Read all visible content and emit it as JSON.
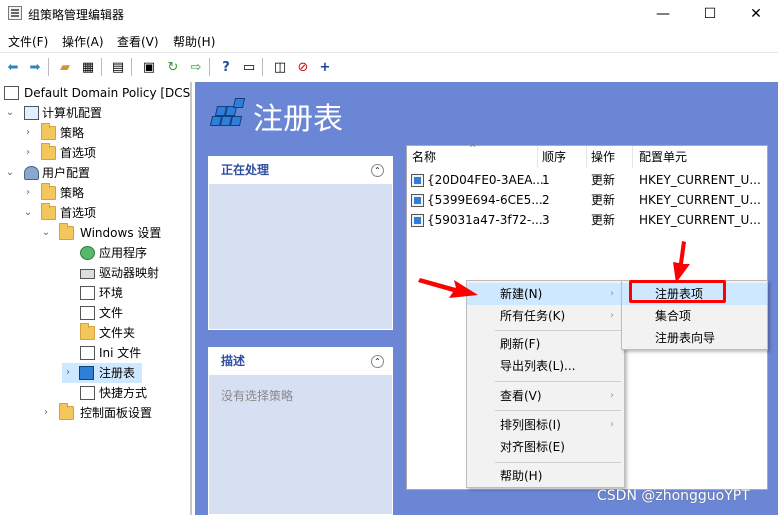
{
  "window": {
    "title": "组策略管理编辑器",
    "controls": {
      "minimize": "—",
      "maximize": "☐",
      "close": "✕"
    }
  },
  "menubar": {
    "items": [
      "文件(F)",
      "操作(A)",
      "查看(V)",
      "帮助(H)"
    ]
  },
  "toolbar": {
    "icons": [
      "back-icon",
      "forward-icon",
      "up-folder-icon",
      "show-tree-icon",
      "properties-icon",
      "print-icon",
      "refresh-icon",
      "export-icon",
      "help-icon",
      "view-icon",
      "filter-icon",
      "stop-icon",
      "add-icon"
    ]
  },
  "tree": {
    "root": "Default Domain Policy [DCSE",
    "computer_config": "计算机配置",
    "policy1": "策略",
    "preferences1": "首选项",
    "user_config": "用户配置",
    "policy2": "策略",
    "preferences2": "首选项",
    "windows_settings": "Windows 设置",
    "apps": "应用程序",
    "drive_maps": "驱动器映射",
    "env": "环境",
    "files": "文件",
    "folders": "文件夹",
    "ini": "Ini 文件",
    "registry": "注册表",
    "shortcuts": "快捷方式",
    "control_panel": "控制面板设置"
  },
  "main": {
    "title": "注册表",
    "processing": {
      "title": "正在处理"
    },
    "description": {
      "title": "描述",
      "body": "没有选择策略"
    }
  },
  "list": {
    "columns": [
      "名称",
      "顺序",
      "操作",
      "配置单元"
    ],
    "rows": [
      {
        "name": "{20D04FE0-3AEA...",
        "order": "1",
        "action": "更新",
        "hive": "HKEY_CURRENT_U..."
      },
      {
        "name": "{5399E694-6CE5...",
        "order": "2",
        "action": "更新",
        "hive": "HKEY_CURRENT_U..."
      },
      {
        "name": "{59031a47-3f72-...",
        "order": "3",
        "action": "更新",
        "hive": "HKEY_CURRENT_U..."
      }
    ]
  },
  "context_menu": {
    "new": "新建(N)",
    "all_tasks": "所有任务(K)",
    "refresh": "刷新(F)",
    "export": "导出列表(L)...",
    "view": "查看(V)",
    "arrange": "排列图标(I)",
    "align": "对齐图标(E)",
    "help": "帮助(H)"
  },
  "submenu": {
    "registry_item": "注册表项",
    "collection_item": "集合项",
    "registry_wizard": "注册表向导"
  },
  "watermark": "CSDN @zhongguoYPT",
  "colors": {
    "main_bg": "#6b86d4",
    "highlight_red": "#ff0000",
    "ctx_bg": "#f2f2f2"
  }
}
